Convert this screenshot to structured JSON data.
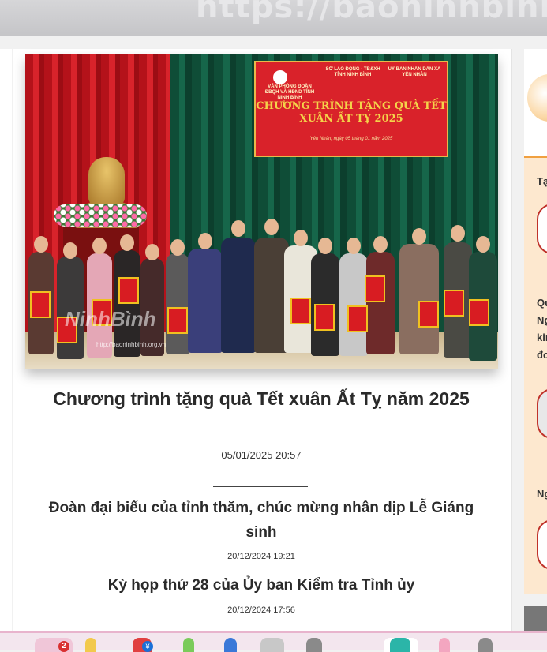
{
  "browser": {
    "url_text": "https://baoninhbinh.org.vn"
  },
  "article": {
    "banner": {
      "org_1": "VĂN PHÒNG ĐOÀN ĐBQH VÀ HĐND TỈNH NINH BÌNH",
      "org_2": "SỞ LAO ĐỘNG - TB&XH TỈNH NINH BÌNH",
      "org_3": "UỶ BAN NHÂN DÂN XÃ YÊN NHÂN",
      "title_line1": "CHƯƠNG TRÌNH TẶNG QUÀ TẾT",
      "title_line2": "XUÂN ẤT TỴ 2025",
      "date_line": "Yên Nhân, ngày 05 tháng 01 năm 2025"
    },
    "watermark": "NinhBình",
    "watermark_url": "http://baoninhbinh.org.vn",
    "headline": "Chương trình tặng quà Tết xuân Ất Tỵ năm 2025",
    "headline_date": "05/01/2025 20:57"
  },
  "news_list": [
    {
      "title": "Đoàn đại biểu của tỉnh thăm, chúc mừng nhân dịp Lễ Giáng sinh",
      "date": "20/12/2024 19:21"
    },
    {
      "title": "Kỳ họp thứ 28 của Ủy ban Kiểm tra Tỉnh ủy",
      "date": "20/12/2024 17:56"
    }
  ],
  "sidebar": {
    "item1": "Tạ",
    "item2_lines": [
      "Qu",
      "Ng",
      "kiı",
      "đc"
    ],
    "item3": "Ng"
  },
  "taskbar": {
    "badge_count": "2"
  },
  "colors": {
    "banner_red": "#d9222a",
    "sidebar_bg": "#fde8cf",
    "accent_orange": "#f0a040"
  }
}
